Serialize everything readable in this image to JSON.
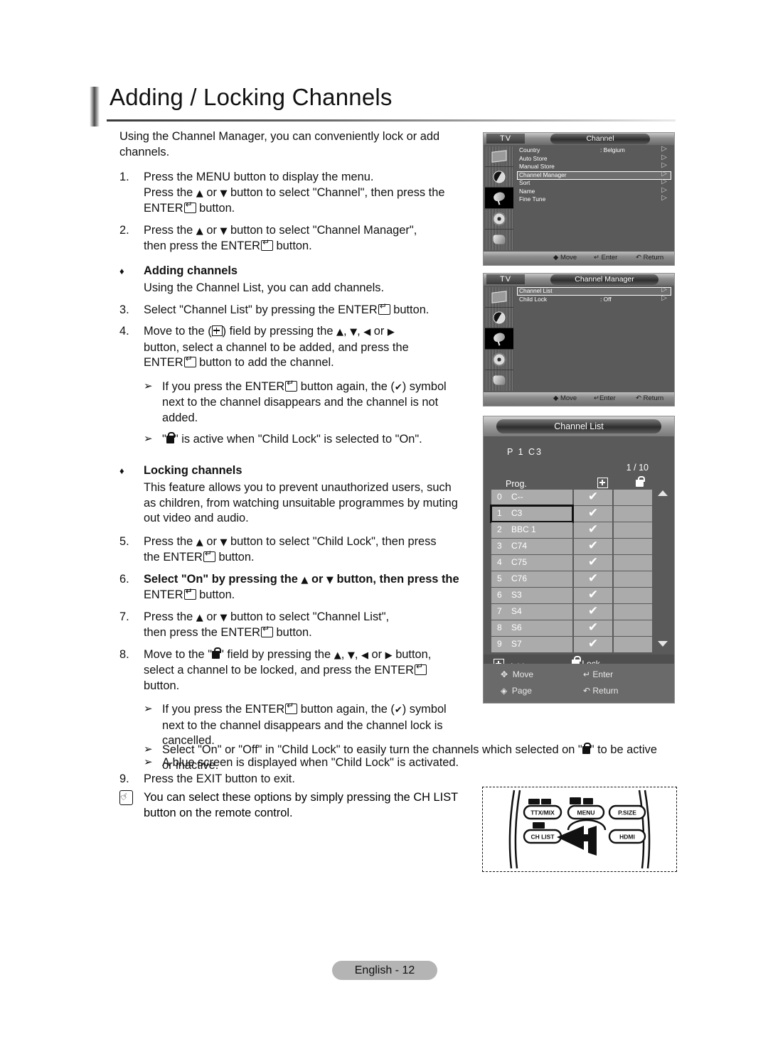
{
  "page": {
    "title": "Adding / Locking Channels",
    "footer": "English - 12"
  },
  "intro": "Using the Channel Manager, you can conveniently lock or add channels.",
  "steps": [
    {
      "num": "1.",
      "line1": "Press the MENU button to display the menu.",
      "line2_a": "Press the ",
      "line2_b": " or ",
      "line2_c": " button to select \"Channel\", then press the",
      "line3": " button."
    },
    {
      "num": "2.",
      "line1_a": "Press the ",
      "line1_b": " or ",
      "line1_c": " button to select \"Channel Manager\",",
      "line2_a": "then press the ENTER",
      "line2_b": " button."
    },
    {
      "num": "3.",
      "line1_a": "Select \"Channel List\" by pressing the ENTER",
      "line1_b": " button."
    },
    {
      "num": "4.",
      "line1_a": "Move to the (",
      "line1_b": ") field by pressing the ",
      "line1_c": ", ",
      "line1_d": ", ",
      "line1_e": " or ",
      "line2": "button, select a channel to be added, and press the",
      "line3_a": "ENTER",
      "line3_b": " button to add the channel."
    },
    {
      "num": "5.",
      "line1_a": "Press the ",
      "line1_b": " or ",
      "line1_c": " button to select \"Child Lock\", then press",
      "line2_a": "the ENTER",
      "line2_b": " button."
    },
    {
      "num": "6.",
      "bold": true,
      "line1_a": "Select \"On\" by pressing the ",
      "line1_b": " or ",
      "line1_c": " button, then press the",
      "line2_a": "ENTER",
      "line2_b": " button."
    },
    {
      "num": "7.",
      "line1_a": "Press the ",
      "line1_b": " or ",
      "line1_c": " button to select \"Channel List\",",
      "line2_a": "then press the ENTER",
      "line2_b": " button."
    },
    {
      "num": "8.",
      "line1_a": "Move to the \"",
      "line1_b": "\" field by pressing the ",
      "line1_c": ", ",
      "line1_d": ", ",
      "line1_e": " or ",
      "line1_f": " button,",
      "line2_a": "select a channel to be locked, and press the ENTER",
      "line3": "button."
    },
    {
      "num": "9.",
      "line1": "Press the EXIT button to exit."
    }
  ],
  "headings": {
    "adding": "Adding channels",
    "adding_sub": "Using the Channel List, you can add channels.",
    "locking": "Locking channels",
    "locking_sub_1": "This feature allows you to prevent unauthorized users, such",
    "locking_sub_2": "as children, from watching unsuitable programmes by muting",
    "locking_sub_3": "out video and audio."
  },
  "notes": {
    "add_again_1a": "If you press the ENTER",
    "add_again_1b": " button again, the (",
    "add_again_1c": ") symbol",
    "add_again_2": "next to the channel disappears and the channel is not",
    "add_again_3": "added.",
    "lock_active_a": "\" is active when \"Child Lock\" is selected to \"On\".",
    "lock_again_1a": "If you press the ENTER",
    "lock_again_1b": " button again, the (",
    "lock_again_1c": ") symbol",
    "lock_again_2": "next to the channel disappears and the channel lock is",
    "lock_again_3": "cancelled.",
    "blue_screen": "A blue screen is displayed when \"Child Lock\" is activated.",
    "onoff_1a": "Select \"On\" or \"Off\" in \"Child Lock\" to easily turn the channels which selected on \"",
    "onoff_1b": "\" to be active",
    "onoff_2": "or inactive.",
    "hand_1": "You can select these options by simply pressing the CH LIST",
    "hand_2": "button on the remote control."
  },
  "osd_channel": {
    "tv_label": "TV",
    "title": "Channel",
    "rows": [
      {
        "label": "Country",
        "value": ": Belgium",
        "selected": false
      },
      {
        "label": "Auto Store",
        "value": "",
        "selected": false
      },
      {
        "label": "Manual Store",
        "value": "",
        "selected": false
      },
      {
        "label": "Channel Manager",
        "value": "",
        "selected": true
      },
      {
        "label": "Sort",
        "value": "",
        "selected": false
      },
      {
        "label": "Name",
        "value": "",
        "selected": false
      },
      {
        "label": "Fine Tune",
        "value": "",
        "selected": false
      }
    ],
    "foot_move": "Move",
    "foot_enter": "Enter",
    "foot_return": "Return",
    "icons": [
      "picture-icon",
      "sound-icon",
      "channel-dish-icon",
      "setup-gear-icon",
      "input-plug-icon"
    ]
  },
  "osd_manager": {
    "tv_label": "TV",
    "title": "Channel Manager",
    "rows": [
      {
        "label": "Channel List",
        "value": "",
        "selected": true
      },
      {
        "label": "Child Lock",
        "value": ": Off",
        "selected": false
      }
    ],
    "foot_move": "Move",
    "foot_enter": "Enter",
    "foot_return": "Return"
  },
  "channel_list": {
    "title": "Channel List",
    "current": "P  1   C3",
    "page": "1 / 10",
    "col_prog": "Prog.",
    "col_add_icon": "add-icon",
    "col_lock_icon": "lock-icon",
    "rows": [
      {
        "num": "0",
        "name": "C--",
        "added": true,
        "locked": false,
        "cursor": false
      },
      {
        "num": "1",
        "name": "C3",
        "added": true,
        "locked": false,
        "cursor": true
      },
      {
        "num": "2",
        "name": "BBC 1",
        "added": true,
        "locked": false,
        "cursor": false
      },
      {
        "num": "3",
        "name": "C74",
        "added": true,
        "locked": false,
        "cursor": false
      },
      {
        "num": "4",
        "name": "C75",
        "added": true,
        "locked": false,
        "cursor": false
      },
      {
        "num": "5",
        "name": "C76",
        "added": true,
        "locked": false,
        "cursor": false
      },
      {
        "num": "6",
        "name": "S3",
        "added": true,
        "locked": false,
        "cursor": false
      },
      {
        "num": "7",
        "name": "S4",
        "added": true,
        "locked": false,
        "cursor": false
      },
      {
        "num": "8",
        "name": "S6",
        "added": true,
        "locked": false,
        "cursor": false
      },
      {
        "num": "9",
        "name": "S7",
        "added": true,
        "locked": false,
        "cursor": false
      }
    ],
    "key_add": "Add",
    "key_lock": "Lock",
    "guide_move": "Move",
    "guide_enter": "Enter",
    "guide_page": "Page",
    "guide_return": "Return"
  },
  "remote": {
    "buttons": [
      "TTX/MIX",
      "MENU",
      "P.SIZE",
      "CH LIST",
      "HDMI"
    ],
    "highlight": "CH LIST"
  },
  "glyphs": {
    "up": "▲",
    "down": "▼",
    "left": "◀",
    "right": "▶",
    "check": "✔",
    "arrow_bullet": "➢",
    "diamond": "♦"
  }
}
